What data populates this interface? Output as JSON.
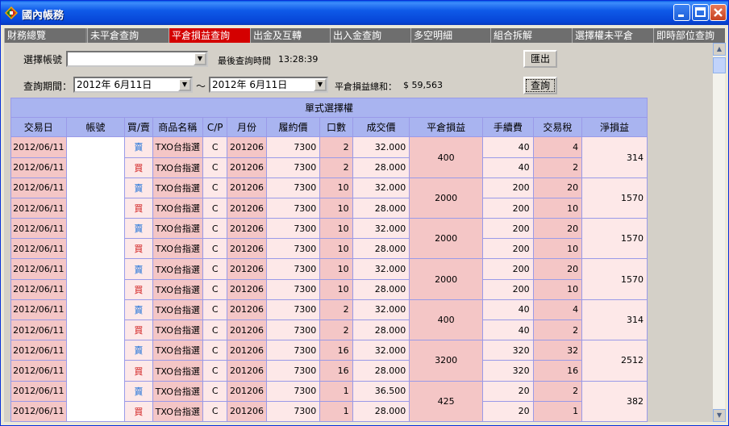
{
  "window": {
    "title": "國內帳務",
    "colors": {
      "titlebar": "#0a5fe8",
      "active_tab": "#d40000",
      "sell": "#1a6fd9",
      "buy": "#d01818",
      "header": "#a9b4f0"
    }
  },
  "tabs": [
    {
      "label": "財務總覽"
    },
    {
      "label": "未平倉查詢"
    },
    {
      "label": "平倉損益查詢",
      "active": true
    },
    {
      "label": "出金及互轉"
    },
    {
      "label": "出入金查詢"
    },
    {
      "label": "多空明細"
    },
    {
      "label": "組合拆解"
    },
    {
      "label": "選擇權未平倉"
    },
    {
      "label": "即時部位查詢"
    }
  ],
  "filters": {
    "account_label": "選擇帳號",
    "account_value": "",
    "last_query_label": "最後查詢時間",
    "last_query_time": "13:28:39",
    "export_button": "匯出",
    "period_label": "查詢期間：",
    "date_from": "2012年  6月11日",
    "separator": "～",
    "date_to": "2012年  6月11日",
    "total_label": "平倉損益總和：",
    "total_value": "$ 59,563",
    "query_button": "查詢"
  },
  "table": {
    "group_title": "單式選擇權",
    "columns": [
      "交易日",
      "帳號",
      "買/賣",
      "商品名稱",
      "C/P",
      "月份",
      "履約價",
      "口數",
      "成交價",
      "平倉損益",
      "手續費",
      "交易稅",
      "淨損益"
    ],
    "groups": [
      {
        "pnl": "400",
        "net": "314",
        "rows": [
          {
            "date": "2012/06/11",
            "side": "賣",
            "product": "TXO台指選",
            "cp": "C",
            "month": "201206",
            "strike": "7300",
            "qty": "2",
            "price": "32.000",
            "fee": "40",
            "tax": "4"
          },
          {
            "date": "2012/06/11",
            "side": "買",
            "product": "TXO台指選",
            "cp": "C",
            "month": "201206",
            "strike": "7300",
            "qty": "2",
            "price": "28.000",
            "fee": "40",
            "tax": "2"
          }
        ]
      },
      {
        "pnl": "2000",
        "net": "1570",
        "rows": [
          {
            "date": "2012/06/11",
            "side": "賣",
            "product": "TXO台指選",
            "cp": "C",
            "month": "201206",
            "strike": "7300",
            "qty": "10",
            "price": "32.000",
            "fee": "200",
            "tax": "20"
          },
          {
            "date": "2012/06/11",
            "side": "買",
            "product": "TXO台指選",
            "cp": "C",
            "month": "201206",
            "strike": "7300",
            "qty": "10",
            "price": "28.000",
            "fee": "200",
            "tax": "10"
          }
        ]
      },
      {
        "pnl": "2000",
        "net": "1570",
        "rows": [
          {
            "date": "2012/06/11",
            "side": "賣",
            "product": "TXO台指選",
            "cp": "C",
            "month": "201206",
            "strike": "7300",
            "qty": "10",
            "price": "32.000",
            "fee": "200",
            "tax": "20"
          },
          {
            "date": "2012/06/11",
            "side": "買",
            "product": "TXO台指選",
            "cp": "C",
            "month": "201206",
            "strike": "7300",
            "qty": "10",
            "price": "28.000",
            "fee": "200",
            "tax": "10"
          }
        ]
      },
      {
        "pnl": "2000",
        "net": "1570",
        "rows": [
          {
            "date": "2012/06/11",
            "side": "賣",
            "product": "TXO台指選",
            "cp": "C",
            "month": "201206",
            "strike": "7300",
            "qty": "10",
            "price": "32.000",
            "fee": "200",
            "tax": "20"
          },
          {
            "date": "2012/06/11",
            "side": "買",
            "product": "TXO台指選",
            "cp": "C",
            "month": "201206",
            "strike": "7300",
            "qty": "10",
            "price": "28.000",
            "fee": "200",
            "tax": "10"
          }
        ]
      },
      {
        "pnl": "400",
        "net": "314",
        "rows": [
          {
            "date": "2012/06/11",
            "side": "賣",
            "product": "TXO台指選",
            "cp": "C",
            "month": "201206",
            "strike": "7300",
            "qty": "2",
            "price": "32.000",
            "fee": "40",
            "tax": "4"
          },
          {
            "date": "2012/06/11",
            "side": "買",
            "product": "TXO台指選",
            "cp": "C",
            "month": "201206",
            "strike": "7300",
            "qty": "2",
            "price": "28.000",
            "fee": "40",
            "tax": "2"
          }
        ]
      },
      {
        "pnl": "3200",
        "net": "2512",
        "rows": [
          {
            "date": "2012/06/11",
            "side": "賣",
            "product": "TXO台指選",
            "cp": "C",
            "month": "201206",
            "strike": "7300",
            "qty": "16",
            "price": "32.000",
            "fee": "320",
            "tax": "32"
          },
          {
            "date": "2012/06/11",
            "side": "買",
            "product": "TXO台指選",
            "cp": "C",
            "month": "201206",
            "strike": "7300",
            "qty": "16",
            "price": "28.000",
            "fee": "320",
            "tax": "16"
          }
        ]
      },
      {
        "pnl": "425",
        "net": "382",
        "rows": [
          {
            "date": "2012/06/11",
            "side": "賣",
            "product": "TXO台指選",
            "cp": "C",
            "month": "201206",
            "strike": "7300",
            "qty": "1",
            "price": "36.500",
            "fee": "20",
            "tax": "2"
          },
          {
            "date": "2012/06/11",
            "side": "買",
            "product": "TXO台指選",
            "cp": "C",
            "month": "201206",
            "strike": "7300",
            "qty": "1",
            "price": "28.000",
            "fee": "20",
            "tax": "1"
          }
        ]
      }
    ]
  },
  "icons": {
    "app": "app-logo-icon",
    "minimize": "minimize-icon",
    "maximize": "maximize-icon",
    "close": "close-icon",
    "dropdown": "dropdown-arrow-icon",
    "scroll_up": "scroll-up-icon",
    "scroll_down": "scroll-down-icon"
  }
}
